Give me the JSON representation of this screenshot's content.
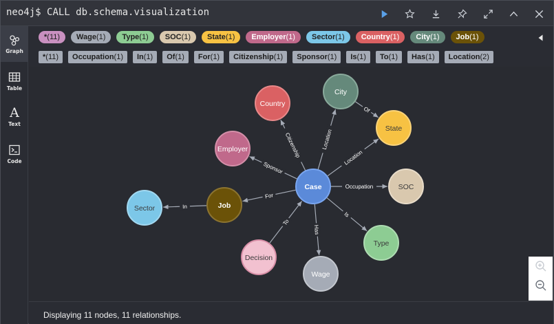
{
  "command": {
    "prompt": "neo4j$",
    "query": "CALL db.schema.visualization"
  },
  "toolbar": {
    "icons": [
      "run-icon",
      "star-icon",
      "download-icon",
      "pin-icon",
      "fullscreen-icon",
      "collapse-up-icon",
      "close-icon"
    ]
  },
  "sidebar": {
    "items": [
      {
        "label": "Graph",
        "icon": "graph-icon"
      },
      {
        "label": "Table",
        "icon": "table-icon"
      },
      {
        "label": "Text",
        "icon": "text-icon"
      },
      {
        "label": "Code",
        "icon": "code-icon"
      }
    ]
  },
  "node_labels": [
    {
      "name": "*",
      "count": "(11)",
      "color": "#c990c0"
    },
    {
      "name": "Wage",
      "count": "(1)",
      "color": "#a5abb6"
    },
    {
      "name": "Type",
      "count": "(1)",
      "color": "#8dcc93"
    },
    {
      "name": "SOC",
      "count": "(1)",
      "color": "#d9c8ae"
    },
    {
      "name": "State",
      "count": "(1)",
      "color": "#f7c243"
    },
    {
      "name": "Employer",
      "count": "(1)",
      "color": "#c0698b"
    },
    {
      "name": "Sector",
      "count": "(1)",
      "color": "#7cc7e8"
    },
    {
      "name": "Country",
      "count": "(1)",
      "color": "#da6163"
    },
    {
      "name": "City",
      "count": "(1)",
      "color": "#65897b"
    },
    {
      "name": "Job",
      "count": "(1)",
      "color": "#6b5208"
    }
  ],
  "relationship_types": [
    {
      "name": "*",
      "count": "(11)"
    },
    {
      "name": "Occupation",
      "count": "(1)"
    },
    {
      "name": "In",
      "count": "(1)"
    },
    {
      "name": "Of",
      "count": "(1)"
    },
    {
      "name": "For",
      "count": "(1)"
    },
    {
      "name": "Citizenship",
      "count": "(1)"
    },
    {
      "name": "Sponsor",
      "count": "(1)"
    },
    {
      "name": "Is",
      "count": "(1)"
    },
    {
      "name": "To",
      "count": "(1)"
    },
    {
      "name": "Has",
      "count": "(1)"
    },
    {
      "name": "Location",
      "count": "(2)"
    }
  ],
  "graph": {
    "nodes": [
      {
        "id": "case",
        "label": "Case",
        "fill": "#5b8ad9",
        "stroke": "#7aa6f0",
        "text": "#ffffff"
      },
      {
        "id": "country",
        "label": "Country",
        "fill": "#da6163",
        "stroke": "#e8898a",
        "text": "#ffffff"
      },
      {
        "id": "city",
        "label": "City",
        "fill": "#65897b",
        "stroke": "#8aaa9c",
        "text": "#ffffff"
      },
      {
        "id": "state",
        "label": "State",
        "fill": "#f7c243",
        "stroke": "#f9d37a",
        "text": "#3a3a3a"
      },
      {
        "id": "employer",
        "label": "Employer",
        "fill": "#c0698b",
        "stroke": "#d48fa9",
        "text": "#ffffff"
      },
      {
        "id": "soc",
        "label": "SOC",
        "fill": "#d9c8ae",
        "stroke": "#e8dcc9",
        "text": "#3a3a3a"
      },
      {
        "id": "job",
        "label": "Job",
        "fill": "#6b5208",
        "stroke": "#8c7430",
        "text": "#ffffff"
      },
      {
        "id": "sector",
        "label": "Sector",
        "fill": "#7cc7e8",
        "stroke": "#a2d8f0",
        "text": "#3a3a3a"
      },
      {
        "id": "decision",
        "label": "Decision",
        "fill": "#f2c1d0",
        "stroke": "#d88fa7",
        "text": "#3a3a3a"
      },
      {
        "id": "wage",
        "label": "Wage",
        "fill": "#a5abb6",
        "stroke": "#c3c7ce",
        "text": "#ffffff"
      },
      {
        "id": "type",
        "label": "Type",
        "fill": "#8dcc93",
        "stroke": "#aedcb2",
        "text": "#3a3a3a"
      }
    ],
    "edges": [
      {
        "from": "case",
        "to": "country",
        "label": "Citizenship"
      },
      {
        "from": "case",
        "to": "city",
        "label": "Location"
      },
      {
        "from": "case",
        "to": "state",
        "label": "Location"
      },
      {
        "from": "city",
        "to": "state",
        "label": "Of"
      },
      {
        "from": "case",
        "to": "employer",
        "label": "Sponsor"
      },
      {
        "from": "case",
        "to": "soc",
        "label": "Occupation"
      },
      {
        "from": "case",
        "to": "job",
        "label": "For"
      },
      {
        "from": "job",
        "to": "sector",
        "label": "In"
      },
      {
        "from": "decision",
        "to": "case",
        "label": "To"
      },
      {
        "from": "case",
        "to": "wage",
        "label": "Has"
      },
      {
        "from": "case",
        "to": "type",
        "label": "Is"
      }
    ]
  },
  "zoom": {
    "in_icon": "zoom-in-icon",
    "out_icon": "zoom-out-icon"
  },
  "status": {
    "text": "Displaying 11 nodes, 11 relationships."
  }
}
